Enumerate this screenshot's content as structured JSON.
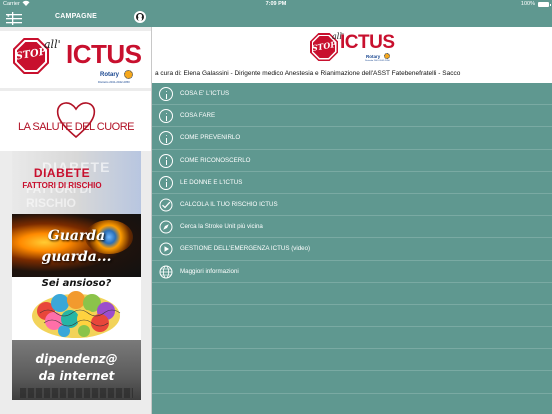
{
  "status_bar": {
    "carrier": "Carrier",
    "time": "7:09 PM",
    "battery": "100%"
  },
  "nav": {
    "title": "CAMPAGNE"
  },
  "sidebar": {
    "campaigns": [
      {
        "id": "ictus",
        "logo": {
          "stop": "STOP",
          "all": "all'",
          "word": "ICTUS",
          "rotary": "Rotary",
          "district": "Distretto 2041-2042-2050"
        }
      },
      {
        "id": "salute-cuore",
        "text": "LA SALUTE DEL CUORE"
      },
      {
        "id": "diabete",
        "title": "DIABETE",
        "subtitle": "FATTORI DI RISCHIO"
      },
      {
        "id": "guarda",
        "line1": "Guarda",
        "line2": "guarda..."
      },
      {
        "id": "ansioso",
        "title": "Sei ansioso?"
      },
      {
        "id": "dipendenza",
        "line1": "dipendenz@",
        "line2": "da internet"
      }
    ]
  },
  "main": {
    "logo": {
      "stop": "STOP",
      "all": "all'",
      "word": "ICTUS",
      "rotary": "Rotary",
      "district": "Distretto 2041-2042-2050"
    },
    "author": "a cura di: Elena Galassini - Dirigente medico Anestesia e Rianimazione dell'ASST Fatebenefratelli - Sacco",
    "menu": [
      {
        "label": "COSA E' L'ICTUS",
        "icon": "info-icon"
      },
      {
        "label": "COSA FARE",
        "icon": "info-icon"
      },
      {
        "label": "COME PREVENIRLO",
        "icon": "info-icon"
      },
      {
        "label": "COME RICONOSCERLO",
        "icon": "info-icon"
      },
      {
        "label": "LE DONNE E L'ICTUS",
        "icon": "info-icon"
      },
      {
        "label": "CALCOLA IL TUO RISCHIO ICTUS",
        "icon": "check-badge-icon"
      },
      {
        "label": "Cerca la Stroke Unit più vicina",
        "icon": "compass-icon"
      },
      {
        "label": "GESTIONE DELL'EMERGENZA ICTUS (video)",
        "icon": "play-icon"
      },
      {
        "label": "Maggiori informazioni",
        "icon": "globe-icon"
      }
    ]
  },
  "colors": {
    "teal": "#5f9890",
    "brand_red": "#c8102e",
    "rotary_blue": "#17458f",
    "rotary_gold": "#f7a81b"
  }
}
